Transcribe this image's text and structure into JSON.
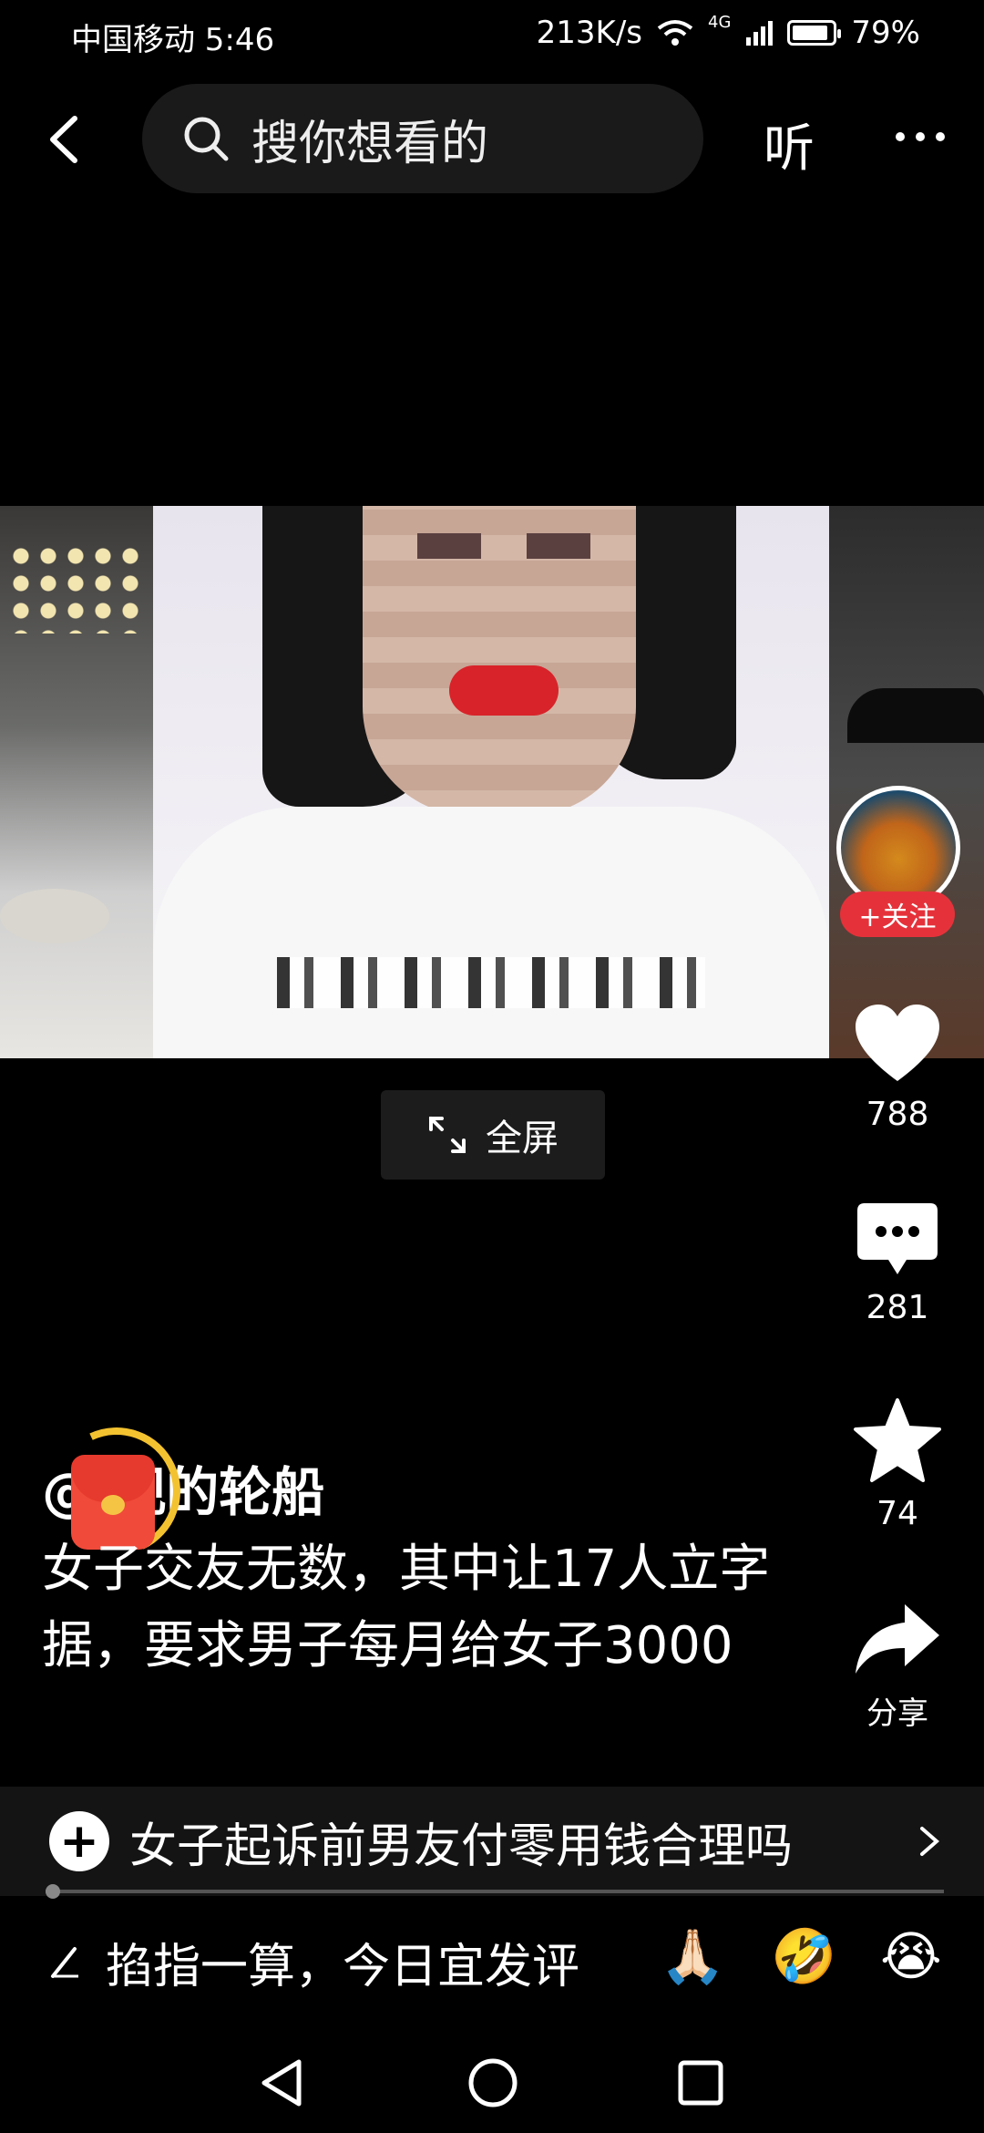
{
  "status_bar": {
    "carrier_time": "中国移动 5:46",
    "speed": "213K/s",
    "network": "4G",
    "battery": "79%"
  },
  "top_bar": {
    "search_placeholder": "搜你想看的",
    "listen_label": "听"
  },
  "video": {
    "fullscreen_label": "全屏"
  },
  "actions": {
    "follow_label": "+关注",
    "like_count": "788",
    "comment_count": "281",
    "favorite_count": "74",
    "share_label": "分享"
  },
  "post": {
    "author": "@  观的轮船",
    "caption": "女子交友无数，其中让17人立字据，要求男子每月给女子3000"
  },
  "related": {
    "title": "女子起诉前男友付零用钱合理吗"
  },
  "comment_bar": {
    "placeholder": "掐指一算，今日宜发评",
    "emojis": [
      "🙏🏻",
      "🤣",
      "😭"
    ]
  },
  "colors": {
    "accent_red": "#e5323a",
    "background": "#000000",
    "ring_gold": "#f3c230"
  }
}
